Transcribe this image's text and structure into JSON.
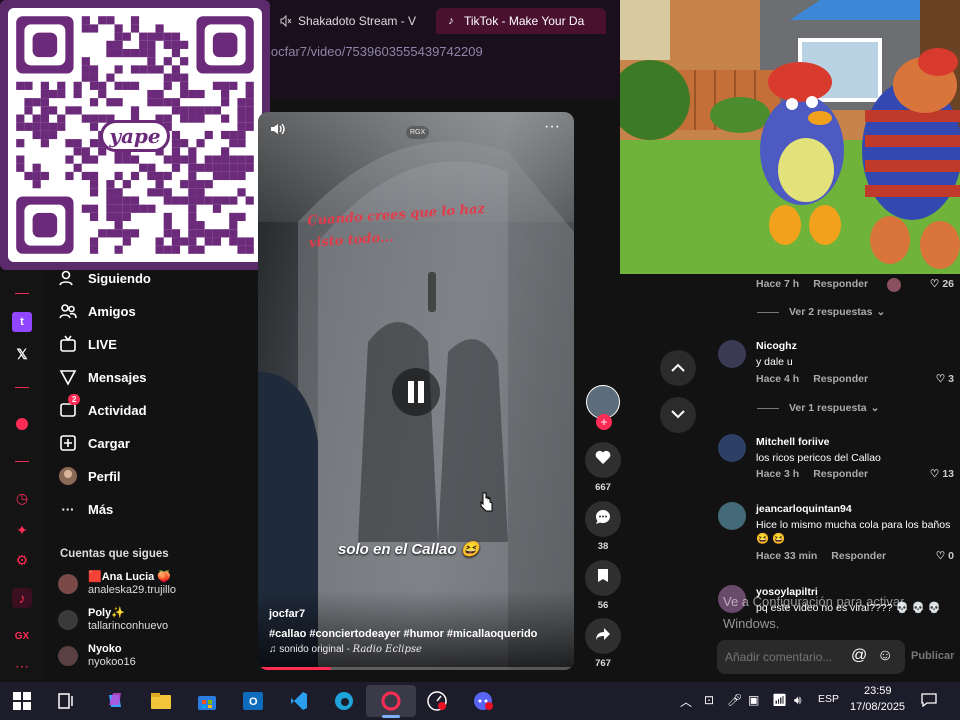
{
  "browser": {
    "tabs": [
      {
        "label": "Shakadoto Stream - V",
        "active": false
      },
      {
        "label": "TikTok - Make Your Da",
        "active": true
      }
    ],
    "url": "jocfar7/video/7539603555439742209"
  },
  "qr": {
    "brand": "yape"
  },
  "sidebar": {
    "items": [
      {
        "label": "Siguiendo",
        "icon": "following-icon"
      },
      {
        "label": "Amigos",
        "icon": "friends-icon"
      },
      {
        "label": "LIVE",
        "icon": "live-icon"
      },
      {
        "label": "Mensajes",
        "icon": "messages-icon"
      },
      {
        "label": "Actividad",
        "icon": "activity-icon",
        "badge": "2"
      },
      {
        "label": "Cargar",
        "icon": "upload-icon"
      },
      {
        "label": "Perfil",
        "icon": "profile-icon"
      },
      {
        "label": "Más",
        "icon": "more-icon"
      }
    ],
    "following_heading": "Cuentas que sigues",
    "following": [
      {
        "name": "🟥Ana Lucia 🍑",
        "handle": "analeska29.trujillo"
      },
      {
        "name": "Poly✨",
        "handle": "tallarinconhuevo"
      },
      {
        "name": "Nyoko",
        "handle": "nyokoo16"
      }
    ]
  },
  "video": {
    "caption_top": "Cuando crees que lo haz visto todo...",
    "caption_mid": "solo en el Callao 😆",
    "watermark": "RGX",
    "author": "jocfar7",
    "hashtags": "#callao #conciertodeayer #humor #micallaoquerido",
    "sound_prefix": "♫ sonido original - ",
    "sound_artist": "Radio Eclipse",
    "progress": 0.23
  },
  "actions": {
    "likes": "667",
    "comments": "38",
    "saves": "56",
    "shares": "767"
  },
  "comments": {
    "top_meta": {
      "time": "Hace 7 h",
      "reply": "Responder",
      "likes": "26"
    },
    "top_thread": "Ver 2 respuestas",
    "items": [
      {
        "user": "Nicoghz",
        "text": "y dale u",
        "time": "Hace 4 h",
        "reply": "Responder",
        "likes": "3",
        "thread": "Ver 1 respuesta"
      },
      {
        "user": "Mitchell foriive",
        "text": "los ricos pericos del Callao",
        "time": "Hace 3 h",
        "reply": "Responder",
        "likes": "13"
      },
      {
        "user": "jeancarloquintan94",
        "text": "Hice lo mismo mucha cola para los baños 😆 😆",
        "time": "Hace 33 min",
        "reply": "Responder",
        "likes": "0"
      },
      {
        "user": "yosoylapiltri",
        "text": "pq este video no es viral???? 💀 💀 💀"
      }
    ],
    "input_placeholder": "Añadir comentario...",
    "publish": "Publicar"
  },
  "windows_watermark": {
    "line1": "Ve a Configuración para activar",
    "line2": "Windows."
  },
  "taskbar": {
    "language": "ESP",
    "time": "23:59",
    "date": "17/08/2025"
  }
}
